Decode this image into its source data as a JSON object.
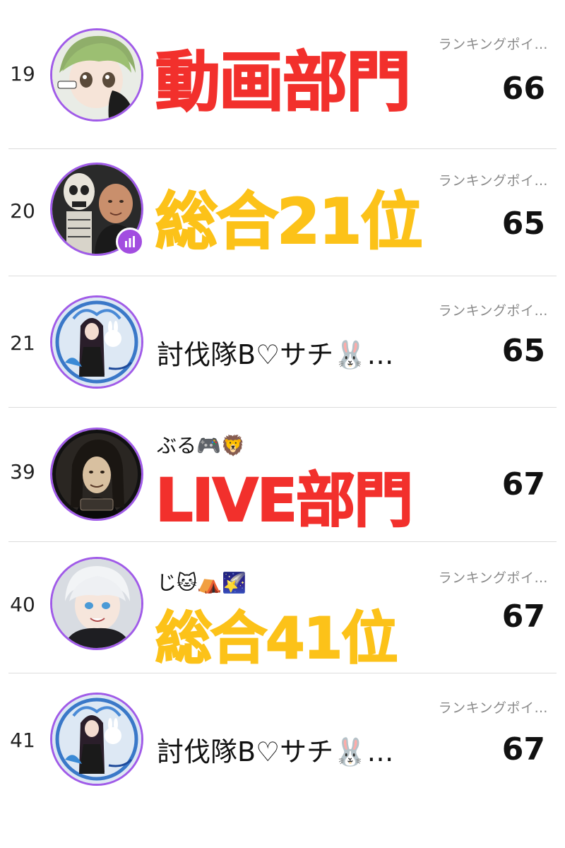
{
  "points_label": "ランキングポイ…",
  "colors": {
    "accent_purple": "#a05be8",
    "overlay_red": "#f2302c",
    "overlay_yellow": "#fcc219",
    "divider": "#dcdcdc",
    "label_gray": "#8a8a8a"
  },
  "rows": [
    {
      "rank": "19",
      "username": "",
      "points": "66",
      "overlay": "動画部門",
      "overlay_color": "red"
    },
    {
      "rank": "20",
      "username": "",
      "points": "65",
      "overlay": "総合21位",
      "overlay_color": "yellow",
      "badge_icon": "bar-chart-icon"
    },
    {
      "rank": "21",
      "username": "討伐隊B♡サチ🐰…",
      "points": "65",
      "overlay": ""
    },
    {
      "rank": "39",
      "username": "ぶる🎮🦁",
      "points": "67",
      "overlay": "LIVE部門",
      "overlay_color": "red"
    },
    {
      "rank": "40",
      "username": "じ🐱⛺🌠",
      "points": "67",
      "overlay": "総合41位",
      "overlay_color": "yellow"
    },
    {
      "rank": "41",
      "username": "討伐隊B♡サチ🐰…",
      "points": "67",
      "overlay": ""
    }
  ]
}
